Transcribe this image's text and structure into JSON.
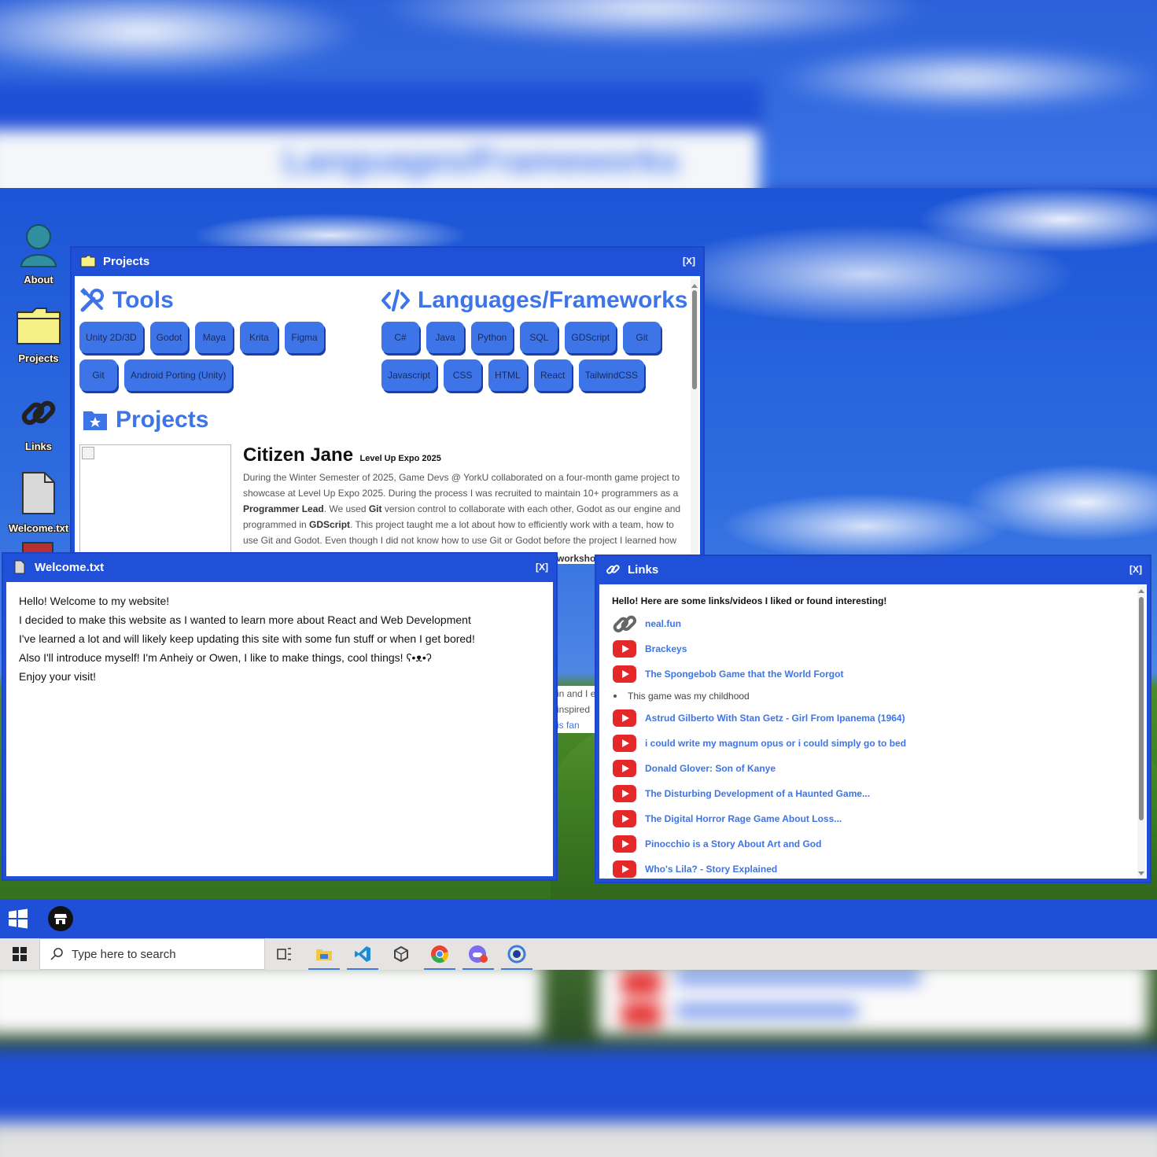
{
  "desktop_icons": [
    {
      "label": "About"
    },
    {
      "label": "Projects"
    },
    {
      "label": "Links"
    },
    {
      "label": "Welcome.txt"
    }
  ],
  "projects_window": {
    "title": "Projects",
    "close": "[X]",
    "tools_title": "Tools",
    "tools": [
      "Unity 2D/3D",
      "Godot",
      "Maya",
      "Krita",
      "Figma",
      "Git",
      "Android Porting (Unity)"
    ],
    "languages_title": "Languages/Frameworks",
    "languages": [
      "C#",
      "Java",
      "Python",
      "SQL",
      "GDScript",
      "Git",
      "Javascript",
      "CSS",
      "HTML",
      "React",
      "TailwindCSS"
    ],
    "projects_title": "Projects",
    "project": {
      "name": "Citizen Jane",
      "event": "Level Up Expo 2025",
      "desc_1": "During the Winter Semester of 2025, Game Devs @ YorkU collaborated on a four-month game project to showcase at Level Up Expo 2025. During the process I was recruited to maintain 10+ programmers as a ",
      "desc_b1": "Programmer Lead",
      "desc_2": ". We used ",
      "desc_b2": "Git",
      "desc_3": " version control to collaborate with each other, Godot as our engine and programmed in ",
      "desc_b3": "GDScript",
      "desc_4": ". This project taught me a lot about how to efficiently work with a team, how to use Git and Godot. Even though I did not know how to use Git or Godot before the project I learned how",
      "frag_workshop": "workshop",
      "frag_1": "in and I e",
      "frag_2": "inspired",
      "frag_3": "is fan"
    }
  },
  "welcome_window": {
    "title": "Welcome.txt",
    "close": "[X]",
    "lines": [
      "Hello! Welcome to my website!",
      "I decided to make this website as I wanted to learn more about React and Web Development",
      "I've learned a lot and will likely keep updating this site with some fun stuff or when I get bored!",
      "Also I'll introduce myself! I'm Anheiy or Owen, I like to make things, cool things! ʕ•ᴥ•ʔ",
      "Enjoy your visit!"
    ]
  },
  "links_window": {
    "title": "Links",
    "close": "[X]",
    "intro": "Hello! Here are some links/videos I liked or found interesting!",
    "items": [
      {
        "type": "link",
        "label": "neal.fun"
      },
      {
        "type": "youtube",
        "label": "Brackeys"
      },
      {
        "type": "youtube",
        "label": "The Spongebob Game that the World Forgot"
      },
      {
        "type": "note",
        "label": "This game was my childhood"
      },
      {
        "type": "youtube",
        "label": "Astrud Gilberto With Stan Getz - Girl From Ipanema (1964)"
      },
      {
        "type": "youtube",
        "label": "i could write my magnum opus or i could simply go to bed"
      },
      {
        "type": "youtube",
        "label": "Donald Glover: Son of Kanye"
      },
      {
        "type": "youtube",
        "label": "The Disturbing Development of a Haunted Game..."
      },
      {
        "type": "youtube",
        "label": "The Digital Horror Rage Game About Loss..."
      },
      {
        "type": "youtube",
        "label": "Pinocchio is a Story About Art and God"
      },
      {
        "type": "youtube",
        "label": "Who's Lila? - Story Explained"
      }
    ]
  },
  "taskbar": {
    "search_placeholder": "Type here to search"
  },
  "backdrop": {
    "blurred_text": "Languages/Frameworks"
  },
  "colors": {
    "accent": "#3d74e8",
    "window_blue": "#2050d8",
    "youtube_red": "#e4282a"
  }
}
